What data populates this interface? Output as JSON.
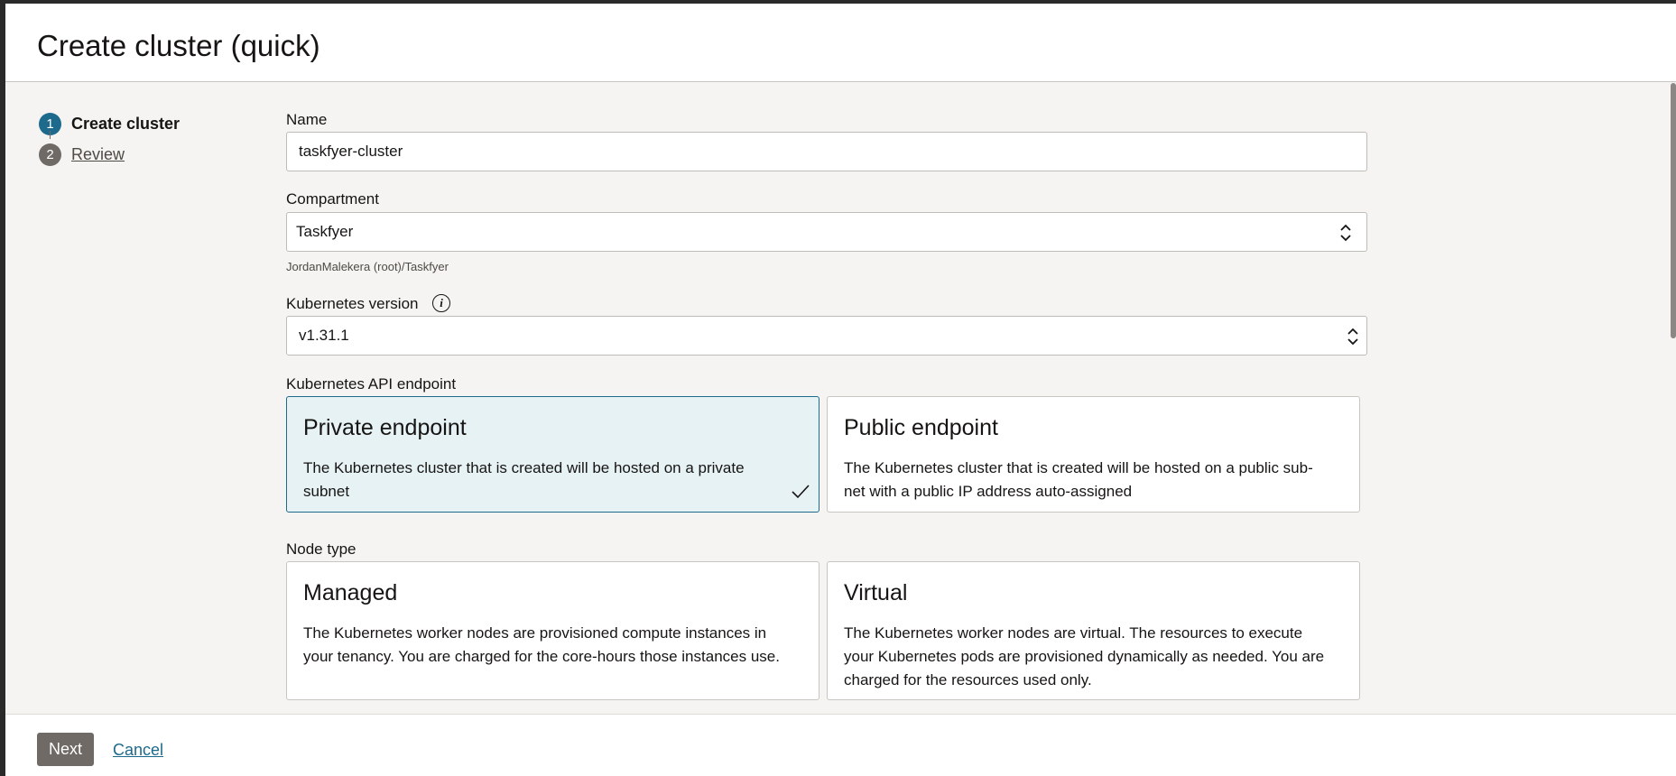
{
  "header": {
    "title": "Create cluster (quick)"
  },
  "steps": [
    {
      "number": "1",
      "label": "Create cluster"
    },
    {
      "number": "2",
      "label": "Review"
    }
  ],
  "form": {
    "name": {
      "label": "Name",
      "value": "taskfyer-cluster"
    },
    "compartment": {
      "label": "Compartment",
      "value": "Taskfyer",
      "helper": "JordanMalekera (root)/Taskfyer"
    },
    "k8s_version": {
      "label": "Kubernetes version",
      "value": "v1.31.1",
      "info_icon": "info-icon"
    },
    "api_endpoint": {
      "label": "Kubernetes API endpoint",
      "options": [
        {
          "title": "Private endpoint",
          "description": "The Kubernetes cluster that is created will be hosted on a private subnet",
          "selected": true
        },
        {
          "title": "Public endpoint",
          "description": "The Kubernetes cluster that is created will be hosted on a public sub-net with a public IP address auto-assigned",
          "selected": false
        }
      ]
    },
    "node_type": {
      "label": "Node type",
      "options": [
        {
          "title": "Managed",
          "description": "The Kubernetes worker nodes are provisioned compute instances in your tenancy. You are charged for the core-hours those instances use."
        },
        {
          "title": "Virtual",
          "description": "The Kubernetes worker nodes are virtual. The resources to execute your Kubernetes pods are provisioned dynamically as needed. You are charged for the resources used only."
        }
      ]
    }
  },
  "footer": {
    "next_label": "Next",
    "cancel_label": "Cancel"
  },
  "colors": {
    "accent": "#1d6a8c",
    "selected_bg": "#e7f2f5",
    "button_bg": "#6f6a66"
  }
}
